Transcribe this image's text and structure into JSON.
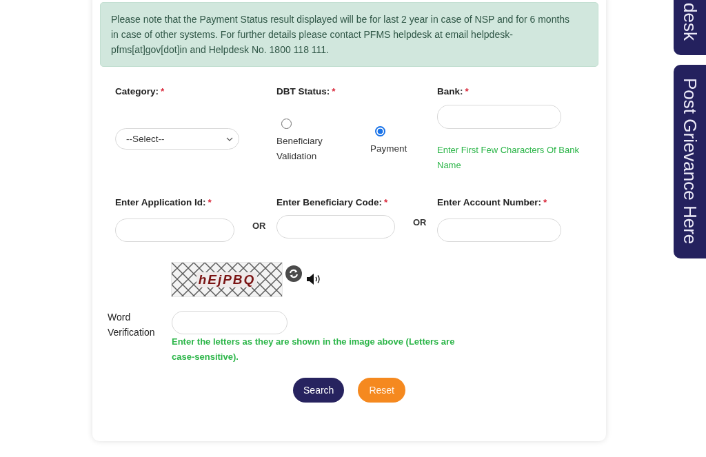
{
  "notice": {
    "text": "Please note that the Payment Status result displayed will be for last 2 year in case of NSP and for 6 months in case of other systems. For further details please contact PFMS helpdesk at email helpdesk-pfms[at]gov[dot]in and Helpdesk No. 1800 118 111."
  },
  "form": {
    "category": {
      "label": "Category:",
      "required_mark": "*",
      "value": "--Select--"
    },
    "dbt_status": {
      "label": "DBT Status:",
      "required_mark": "*",
      "options": [
        {
          "label": "Beneficiary Validation",
          "selected": false
        },
        {
          "label": "Payment",
          "selected": true
        }
      ]
    },
    "bank": {
      "label": "Bank:",
      "required_mark": "*",
      "hint": "Enter First Few Characters Of Bank Name"
    },
    "id_fields": [
      {
        "label": "Enter Application Id:",
        "required_mark": "*",
        "separator": "OR"
      },
      {
        "label": "Enter Beneficiary Code:",
        "required_mark": "*",
        "separator": "OR"
      },
      {
        "label": "Enter Account Number:",
        "required_mark": "*"
      }
    ]
  },
  "captcha": {
    "text": "hEjPBQ"
  },
  "word_verification": {
    "label": "Word Verification",
    "hint": "Enter the letters as they are shown in the image above (Letters are case-sensitive)."
  },
  "buttons": [
    {
      "label": "Search",
      "kind": "primary"
    },
    {
      "label": "Reset",
      "kind": "warning"
    }
  ],
  "side_tabs": [
    {
      "label": "desk"
    },
    {
      "label": "Post Grievance Here"
    }
  ]
}
